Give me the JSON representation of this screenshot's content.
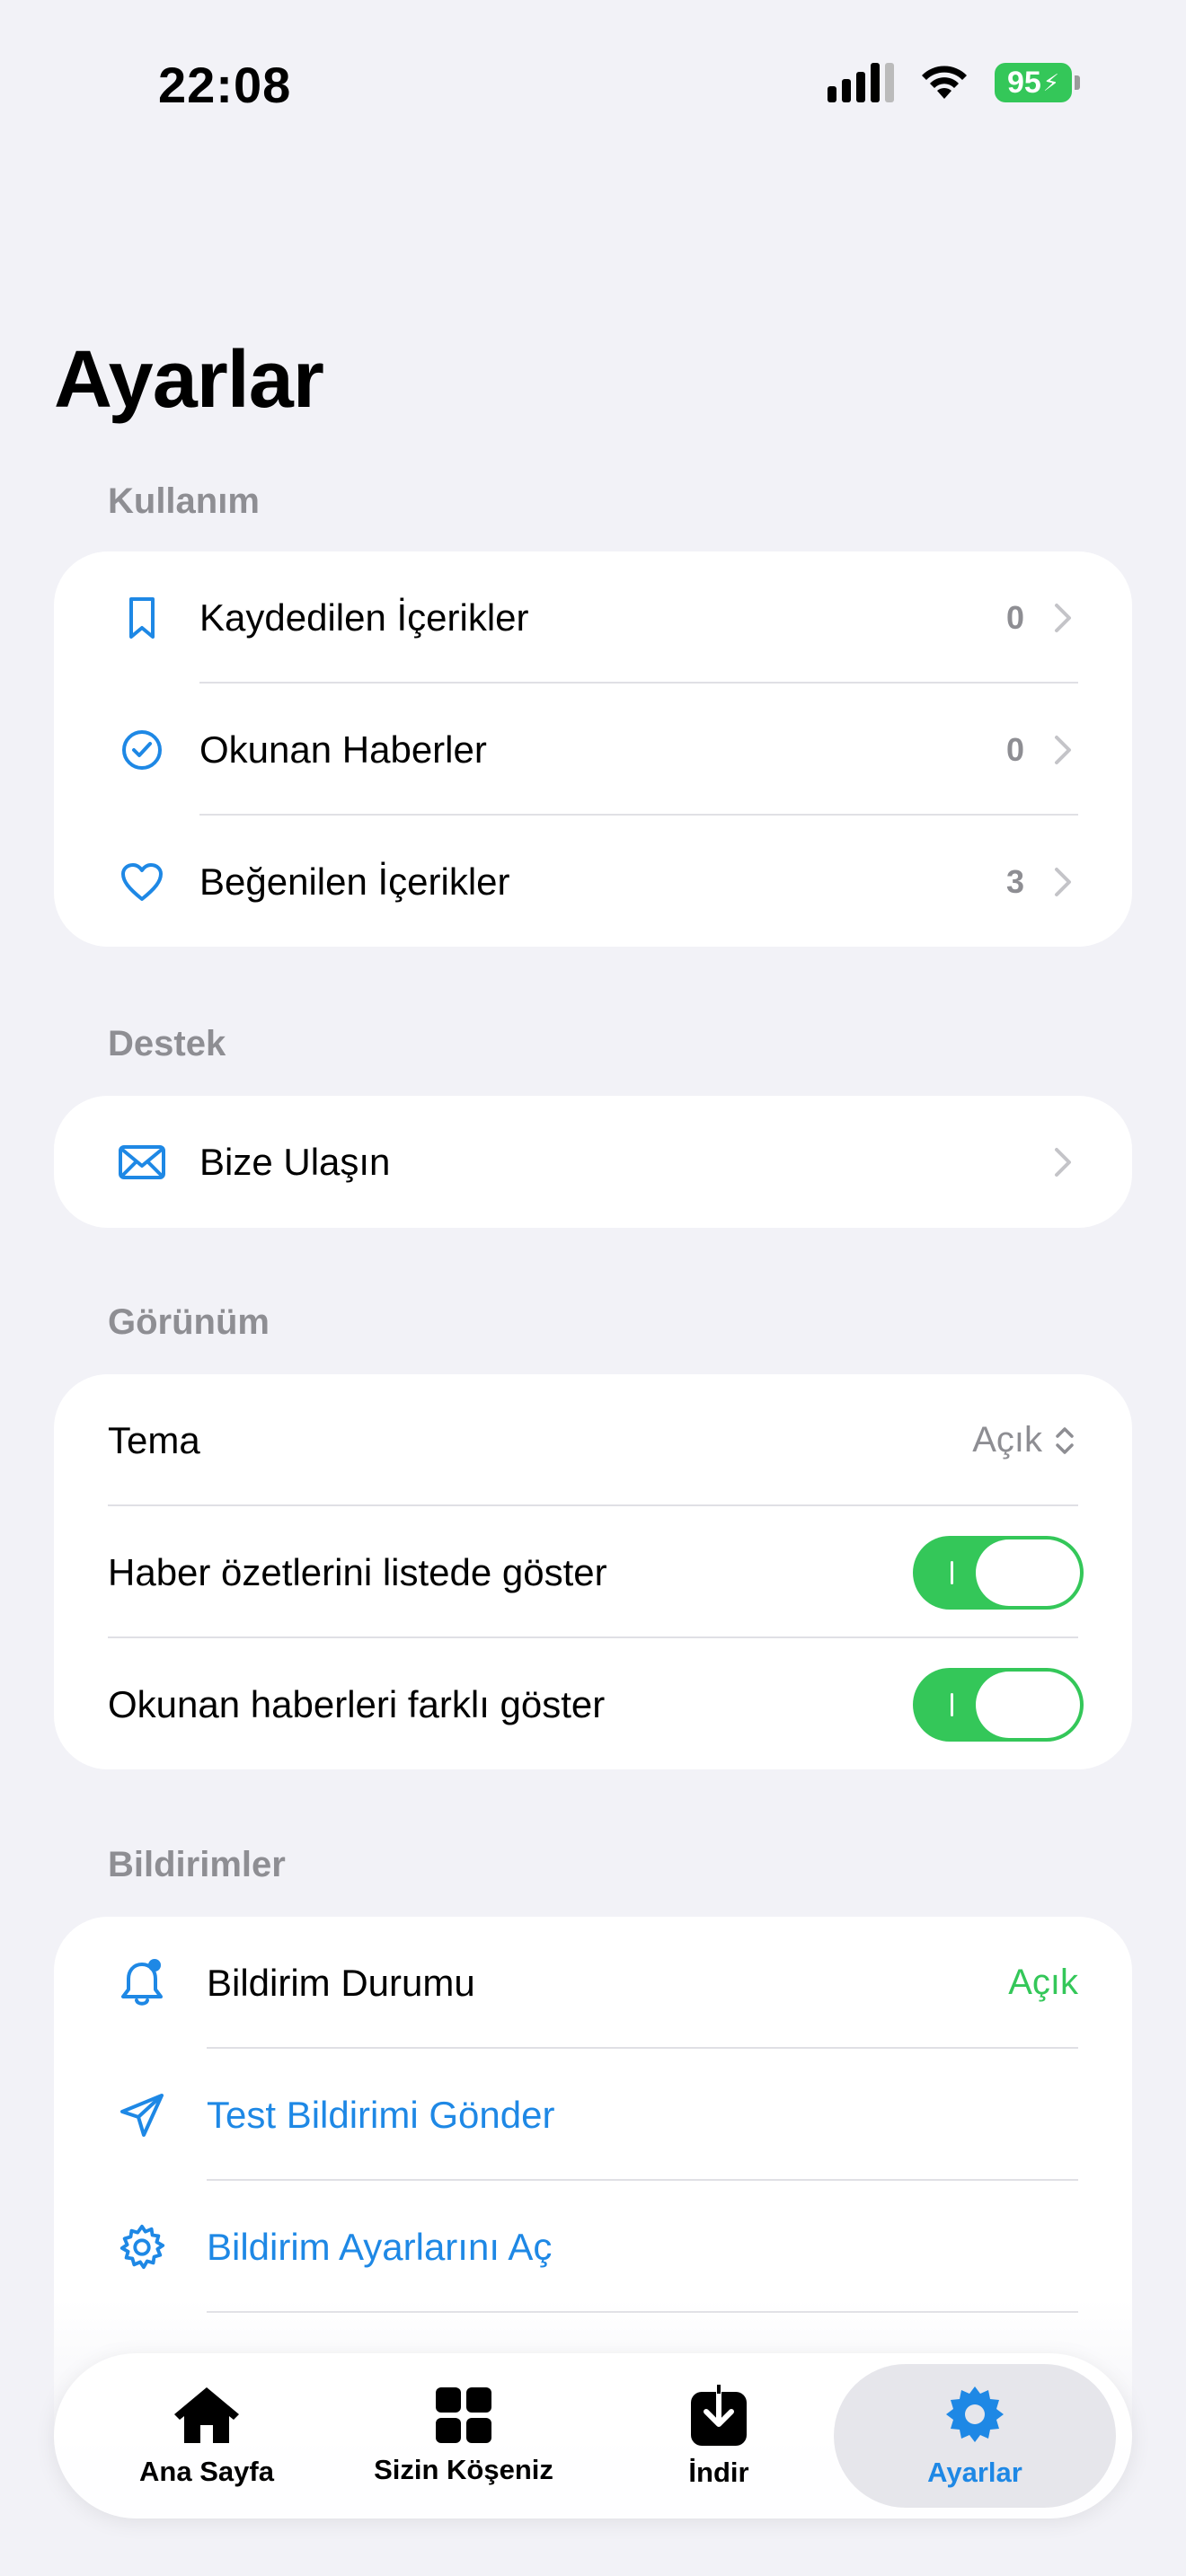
{
  "status_bar": {
    "time": "22:08",
    "battery": "95"
  },
  "title": "Ayarlar",
  "usage": {
    "header": "Kullanım",
    "items": [
      {
        "label": "Kaydedilen İçerikler",
        "count": "0",
        "icon": "bookmark-icon"
      },
      {
        "label": "Okunan Haberler",
        "count": "0",
        "icon": "checkmark-circle-icon"
      },
      {
        "label": "Beğenilen İçerikler",
        "count": "3",
        "icon": "heart-icon"
      }
    ]
  },
  "support": {
    "header": "Destek",
    "items": [
      {
        "label": "Bize Ulaşın",
        "icon": "envelope-icon"
      }
    ]
  },
  "appearance": {
    "header": "Görünüm",
    "theme_label": "Tema",
    "theme_value": "Açık",
    "summary_label": "Haber özetlerini listede göster",
    "summary_on": true,
    "read_label": "Okunan haberleri farklı göster",
    "read_on": true
  },
  "notifications": {
    "header": "Bildirimler",
    "status_label": "Bildirim Durumu",
    "status_value": "Açık",
    "test_label": "Test Bildirimi Gönder",
    "settings_label": "Bildirim Ayarlarını Aç"
  },
  "tabs": [
    {
      "label": "Ana Sayfa",
      "icon": "house-icon"
    },
    {
      "label": "Sizin Köşeniz",
      "icon": "grid-icon"
    },
    {
      "label": "İndir",
      "icon": "download-icon"
    },
    {
      "label": "Ayarlar",
      "icon": "gear-icon"
    }
  ],
  "colors": {
    "accent": "#1E88E5",
    "green": "#34C759",
    "secondary": "#8E8E93",
    "background": "#F2F2F7"
  }
}
